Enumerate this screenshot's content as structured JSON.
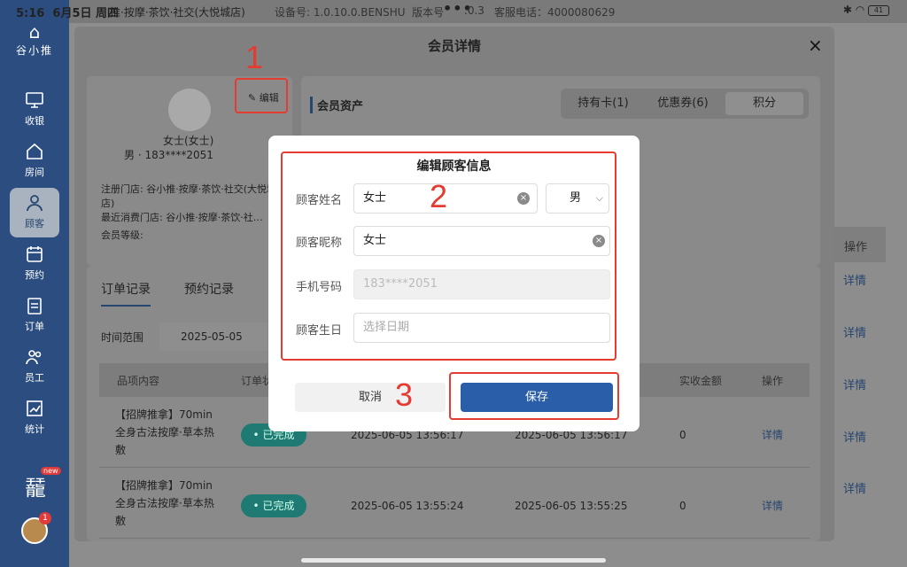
{
  "status_bar": {
    "time": "5:16",
    "date": "6月5日 周四",
    "store": "推·按摩·茶饮·社交(大悦城店)",
    "device": "设备号: 1.0.10.0.BENSHU",
    "version": "版本号",
    "version_tail": ".0.3",
    "hotline": "客服电话：4000080629",
    "battery": "41"
  },
  "sidebar": {
    "logo_text": "谷小推",
    "items": [
      {
        "label": "收银",
        "icon": "monitor-icon"
      },
      {
        "label": "房间",
        "icon": "home-icon"
      },
      {
        "label": "顾客",
        "icon": "user-icon"
      },
      {
        "label": "预约",
        "icon": "calendar-icon"
      },
      {
        "label": "订单",
        "icon": "clipboard-icon"
      },
      {
        "label": "员工",
        "icon": "people-icon"
      },
      {
        "label": "统计",
        "icon": "chart-icon"
      }
    ],
    "active_index": 2,
    "new_badge": "new",
    "notif_count": "1"
  },
  "panel": {
    "title": "会员详情",
    "close": "×",
    "profile": {
      "name": "女士(女士)",
      "gender_phone": "男 · 183****2051",
      "register_store_label": "注册门店: 谷小推·按摩·茶饮·社交(大悦城店)",
      "last_store_label": "最近消费门店: 谷小推·按摩·茶饮·社…",
      "level_label": "会员等级:",
      "edit": "编辑"
    },
    "assets": {
      "title": "会员资产",
      "tabs": [
        "持有卡(1)",
        "优惠券(6)",
        "积分"
      ],
      "selected": 2
    },
    "order_tabs": [
      "订单记录",
      "预约记录"
    ],
    "range_label": "时间范围",
    "range_start": "2025-05-05",
    "table": {
      "headers": [
        "品项内容",
        "订单状",
        "",
        "",
        "实收金额",
        "操作"
      ],
      "rows": [
        {
          "item": "【招牌推拿】70min全身古法按摩·草本热敷",
          "status": "• 已完成",
          "time1": "2025-06-05 13:56:17",
          "time2": "2025-06-05 13:56:17",
          "amount": "0",
          "action": "详情"
        },
        {
          "item": "【招牌推拿】70min全身古法按摩·草本热敷",
          "status": "• 已完成",
          "time1": "2025-06-05 13:55:24",
          "time2": "2025-06-05 13:55:25",
          "amount": "0",
          "action": "详情"
        }
      ]
    }
  },
  "background": {
    "ops_header": "操作",
    "detail_links": [
      "详情",
      "详情",
      "详情",
      "详情",
      "详情"
    ]
  },
  "dialog": {
    "title": "编辑顾客信息",
    "name_label": "顾客姓名",
    "name_value": "女士",
    "gender_value": "男",
    "nickname_label": "顾客昵称",
    "nickname_value": "女士",
    "phone_label": "手机号码",
    "phone_value": "183****2051",
    "birthday_label": "顾客生日",
    "birthday_placeholder": "选择日期",
    "cancel": "取消",
    "save": "保存"
  },
  "annotations": {
    "step1": "1",
    "step2": "2",
    "step3": "3",
    "color": "#e53b30"
  }
}
